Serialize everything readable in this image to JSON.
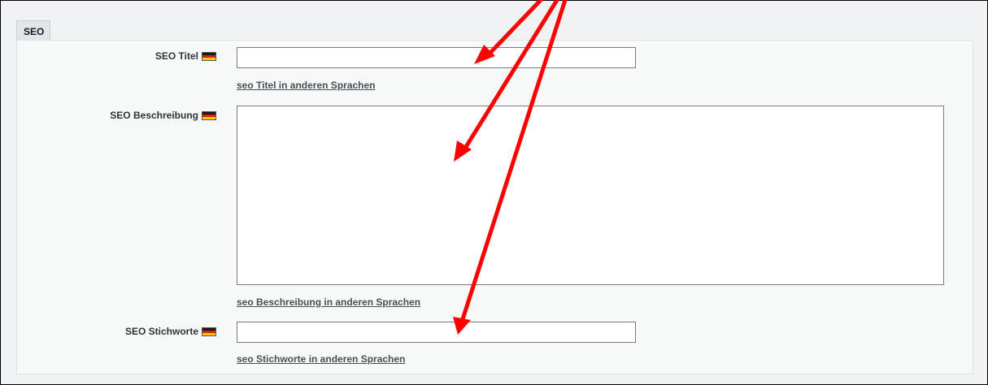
{
  "section": {
    "title": "SEO"
  },
  "fields": {
    "title": {
      "label": "SEO Titel",
      "value": "",
      "link": "seo Titel in anderen Sprachen"
    },
    "description": {
      "label": "SEO Beschreibung",
      "value": "",
      "link": "seo Beschreibung in anderen Sprachen"
    },
    "keywords": {
      "label": "SEO Stichworte",
      "value": "",
      "link": "seo Stichworte in anderen Sprachen"
    }
  },
  "icons": {
    "language_flag": "german-flag-icon"
  },
  "colors": {
    "annotation_arrow": "#ff0000",
    "panel_bg": "#f7f8f8",
    "link": "#4a4f55"
  }
}
